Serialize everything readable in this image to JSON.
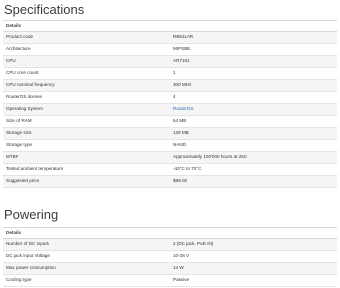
{
  "specifications": {
    "title": "Specifications",
    "header": "Details",
    "rows": [
      {
        "label": "Product code",
        "value": "RB911AR"
      },
      {
        "label": "Architecture",
        "value": "MIPSBE"
      },
      {
        "label": "CPU",
        "value": "AR7161"
      },
      {
        "label": "CPU core count",
        "value": "1"
      },
      {
        "label": "CPU nominal frequency",
        "value": "300 MHz"
      },
      {
        "label": "RouterOS license",
        "value": "4"
      },
      {
        "label": "Operating System",
        "value": "RouterOS",
        "link": true
      },
      {
        "label": "Size of RAM",
        "value": "64 MB"
      },
      {
        "label": "Storage size",
        "value": "128 MB"
      },
      {
        "label": "Storage type",
        "value": "NAND"
      },
      {
        "label": "MTBF",
        "value": "Approximately 100'000 hours at 25C"
      },
      {
        "label": "Tested ambient temperature",
        "value": "-40°C to 70°C"
      },
      {
        "label": "Suggested price",
        "value": "$99.00"
      }
    ]
  },
  "powering": {
    "title": "Powering",
    "header": "Details",
    "rows": [
      {
        "label": "Number of DC inputs",
        "value": "2 (DC jack, PoE-IN)"
      },
      {
        "label": "DC jack input Voltage",
        "value": "10-28 V"
      },
      {
        "label": "Max power consumption",
        "value": "14 W"
      },
      {
        "label": "Cooling type",
        "value": "Passive"
      }
    ]
  }
}
